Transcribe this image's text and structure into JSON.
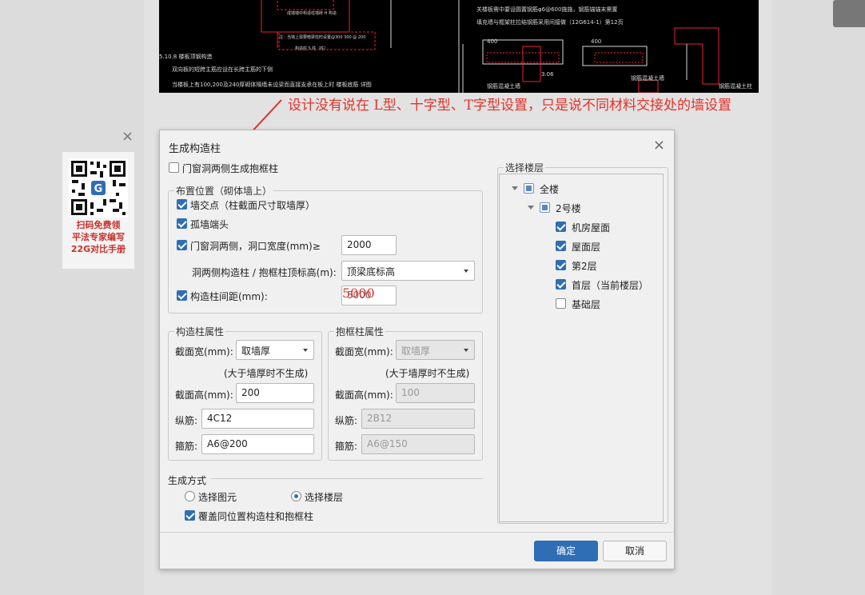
{
  "annotation": {
    "text": "设计没有说在 L型、十字型、T字型设置，只是说不同材料交接处的墙设置",
    "color": "#e0332b"
  },
  "ad": {
    "lines": [
      "扫码免费领",
      "平法专家编写",
      "22G对比手册"
    ],
    "close": "×"
  },
  "cad": {
    "texts": [
      "5.10.8 楼板顶钢构造",
      "双向板的短跨主筋应设在长跨主筋的下侧",
      "当楼板上有100,200及240厚砌体隔墙未设梁而直接支承在板上时 楼板底筋 详图",
      "关楼板需中要设圆置钢筋φ6@600施施，钢筋锚锚末需置",
      "填充墙与框架柱拉结钢筋采用间接做（12G614-1）第12页",
      "400",
      "400",
      "3.06",
      "钢筋混凝土墙",
      "钢筋混凝土墙",
      "钢筋混凝土柱",
      "注：当墙上需要暗梁柱时设置@300  300 @ 200",
      "成墙墙中构造柱墙砖 H 构造",
      "构造柱 S 柱（柱）"
    ]
  },
  "dialog": {
    "title": "生成构造柱",
    "close": "×",
    "door_window_frame": {
      "label": "门窗洞两侧生成抱框柱",
      "checked": false
    },
    "layout_group": {
      "title": "布置位置（砌体墙上）",
      "wall_intersection": {
        "label": "墙交点（柱截面尺寸取墙厚）",
        "checked": true
      },
      "isolated_wall_end": {
        "label": "孤墙端头",
        "checked": true
      },
      "opening_sides": {
        "label": "门窗洞两侧，洞口宽度(mm)≥",
        "checked": true,
        "value": "2000"
      },
      "top_elevation": {
        "label": "洞两侧构造柱 / 抱框柱顶标高(m):",
        "value": "顶梁底标高"
      },
      "spacing": {
        "label": "构造柱间距(mm):",
        "checked": true,
        "value": "5000",
        "overlay": "5000"
      }
    },
    "column_props": {
      "title": "构造柱属性",
      "width_label": "截面宽(mm):",
      "width_value": "取墙厚",
      "note": "(大于墙厚时不生成)",
      "height_label": "截面高(mm):",
      "height_value": "200",
      "long_bar_label": "纵筋:",
      "long_bar_value": "4C12",
      "stirrup_label": "箍筋:",
      "stirrup_value": "A6@200"
    },
    "frame_props": {
      "title": "抱框柱属性",
      "width_label": "截面宽(mm):",
      "width_value": "取墙厚",
      "note": "(大于墙厚时不生成)",
      "height_label": "截面高(mm):",
      "height_value": "100",
      "long_bar_label": "纵筋:",
      "long_bar_value": "2B12",
      "stirrup_label": "箍筋:",
      "stirrup_value": "A6@150"
    },
    "generate_mode": {
      "title": "生成方式",
      "select_element": {
        "label": "选择图元",
        "selected": false
      },
      "select_floor": {
        "label": "选择楼层",
        "selected": true
      },
      "overwrite": {
        "label": "覆盖同位置构造柱和抱框柱",
        "checked": true
      }
    },
    "floors": {
      "title": "选择楼层",
      "root": {
        "label": "全楼",
        "state": "partial"
      },
      "building": {
        "label": "2号楼",
        "state": "partial"
      },
      "items": [
        {
          "label": "机房屋面",
          "checked": true
        },
        {
          "label": "屋面层",
          "checked": true
        },
        {
          "label": "第2层",
          "checked": true
        },
        {
          "label": "首层（当前楼层）",
          "checked": true
        },
        {
          "label": "基础层",
          "checked": false
        }
      ]
    },
    "ok": "确定",
    "cancel": "取消"
  }
}
